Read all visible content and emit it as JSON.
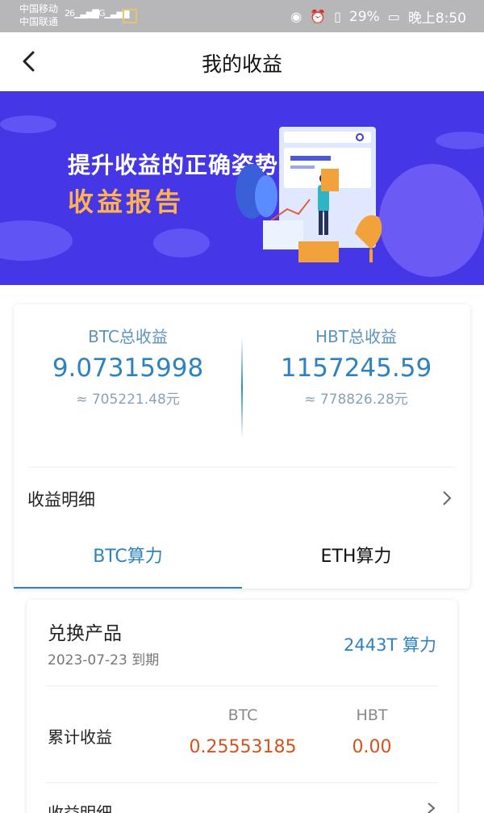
{
  "status_bar": {
    "carrier_1": "中国移动",
    "carrier_2": "中国联通",
    "signal_1": "26",
    "signal_2": "4G",
    "battery": "29%",
    "time": "晚上8:50",
    "icons": [
      "eye-icon",
      "alarm-icon",
      "vibrate-icon",
      "battery-icon"
    ]
  },
  "header": {
    "title": "我的收益"
  },
  "banner": {
    "line1": "提升收益的正确姿势",
    "line2": "收益报告"
  },
  "summary": {
    "btc": {
      "label": "BTC总收益",
      "value": "9.07315998",
      "fiat": "≈ 705221.48元"
    },
    "hbt": {
      "label": "HBT总收益",
      "value": "1157245.59",
      "fiat": "≈ 778826.28元"
    },
    "detail_label": "收益明细"
  },
  "tabs": [
    {
      "label": "BTC算力",
      "active": true
    },
    {
      "label": "ETH算力",
      "active": false
    }
  ],
  "product": {
    "title": "兑换产品",
    "date": "2023-07-23 到期",
    "power": "2443T 算力",
    "cumulative_label": "累计收益",
    "col_btc": "BTC",
    "col_hbt": "HBT",
    "val_btc": "0.25553185",
    "val_hbt": "0.00",
    "detail_label": "收益明细"
  },
  "colors": {
    "accent": "#2e82bf",
    "banner_bg": "#4536e6",
    "banner_highlight": "#ffb24d",
    "earning": "#d2531c"
  }
}
